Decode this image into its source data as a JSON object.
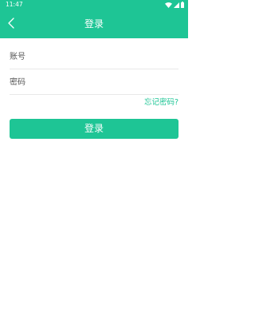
{
  "status_bar": {
    "time": "11:47"
  },
  "header": {
    "title": "登录",
    "back_icon": "chevron-left-icon"
  },
  "form": {
    "account_placeholder": "账号",
    "account_value": "",
    "password_placeholder": "密码",
    "password_value": ""
  },
  "forgot_password_label": "忘记密码?",
  "login_button_label": "登录",
  "colors": {
    "brand": "#1ec595",
    "text": "#333333",
    "divider": "#e8e8e8",
    "background": "#ffffff"
  }
}
